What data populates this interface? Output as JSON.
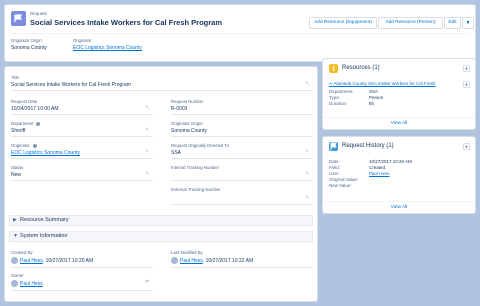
{
  "header": {
    "object_type": "Request",
    "title": "Social Services Intake Workers for Cal Fresh Program",
    "buttons": {
      "add_equipment": "Add Resource (Equipment)",
      "add_person": "Add Resource (Person)",
      "edit": "Edit"
    },
    "fields": [
      {
        "label": "Originator Origin",
        "value": "Sonoma County"
      },
      {
        "label": "Originator",
        "value": "EOC Logistics Sonoma County"
      }
    ]
  },
  "details": {
    "title_label": "Title",
    "title_value": "Social Services Intake Workers for Cal Fresh Program",
    "request_date_label": "Request Date",
    "request_date_value": "10/24/2017 10:00 AM",
    "request_number_label": "Request Number",
    "request_number_value": "R-0003",
    "department_label": "Department",
    "department_value": "Sheriff",
    "originator_origin_label": "Originator Origin",
    "originator_origin_value": "Sonoma County",
    "originator_label": "Originator",
    "originator_value": "EOC Logistics Sonoma County",
    "directed_to_label": "Request Originally Directed To",
    "directed_to_value": "SSA",
    "status_label": "Status",
    "status_value": "New",
    "internal_tracking_label": "Internal Tracking Number",
    "external_tracking_label": "External Tracking Number"
  },
  "sections": {
    "resource_summary": "Resource Summary",
    "system_information": "System Information"
  },
  "system_info": {
    "created_by_label": "Created By",
    "created_by_name": "Paul Hess",
    "created_by_date": ", 10/27/2017 10:20 AM",
    "modified_by_label": "Last Modified By",
    "modified_by_name": "Paul Hess",
    "modified_by_date": ", 10/27/2017 10:22 AM",
    "owner_label": "Owner",
    "owner_name": "Paul Hess"
  },
  "resources_card": {
    "title": "Resources (1)",
    "item_link": "A-Alameda County SSA Intake Workers for Cal Fresh",
    "rows": [
      {
        "label": "Department:",
        "value": "SSA"
      },
      {
        "label": "Type:",
        "value": "Person"
      },
      {
        "label": "Duration:",
        "value": "8h"
      }
    ],
    "view_all": "View All"
  },
  "history_card": {
    "title": "Request History (1)",
    "rows": [
      {
        "label": "Date:",
        "value": "10/27/2017 10:20 AM"
      },
      {
        "label": "Field:",
        "value": "Created."
      },
      {
        "label": "User:",
        "value": "Paul Hess"
      },
      {
        "label": "Original Value:",
        "value": ""
      },
      {
        "label": "New Value:",
        "value": ""
      }
    ],
    "view_all": "View All"
  },
  "colors": {
    "background": "#b0c4df",
    "record_icon": "#7f8de1",
    "resources_icon": "#f4bc25",
    "history_icon": "#3c97dd",
    "link": "#0070d2"
  }
}
